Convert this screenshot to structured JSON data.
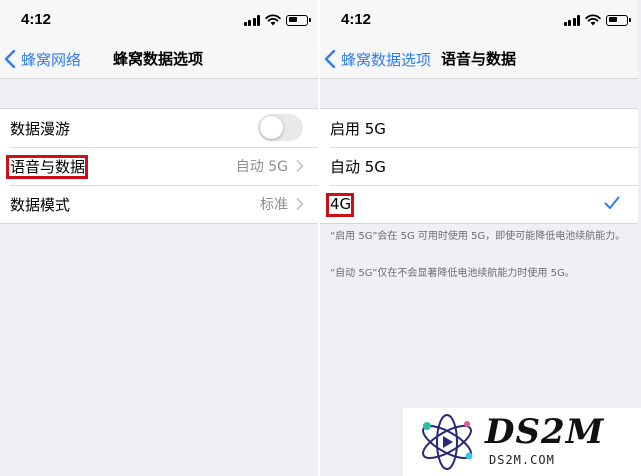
{
  "left_screen": {
    "status_time": "4:12",
    "nav": {
      "back_label": "蜂窝网络",
      "title": "蜂窝数据选项"
    },
    "rows": [
      {
        "label": "数据漫游",
        "toggle_on": false
      },
      {
        "label": "语音与数据",
        "value": "自动 5G"
      },
      {
        "label": "数据模式",
        "value": "标准"
      }
    ]
  },
  "right_screen": {
    "status_time": "4:12",
    "nav": {
      "back_label": "蜂窝数据选项",
      "title": "语音与数据"
    },
    "options": [
      {
        "label": "启用 5G",
        "selected": false
      },
      {
        "label": "自动 5G",
        "selected": false
      },
      {
        "label": "4G",
        "selected": true
      }
    ],
    "footnotes": [
      "“启用 5G”会在 5G 可用时使用 5G，即使可能降低电池续航能力。",
      "“自动 5G”仅在不会显著降低电池续航能力时使用 5G。"
    ]
  },
  "watermark": {
    "title": "DS2M",
    "subtitle": "DS2M.COM"
  },
  "colors": {
    "accent": "#2f7cf6",
    "highlight": "#d10e18",
    "background": "#efeff4"
  }
}
